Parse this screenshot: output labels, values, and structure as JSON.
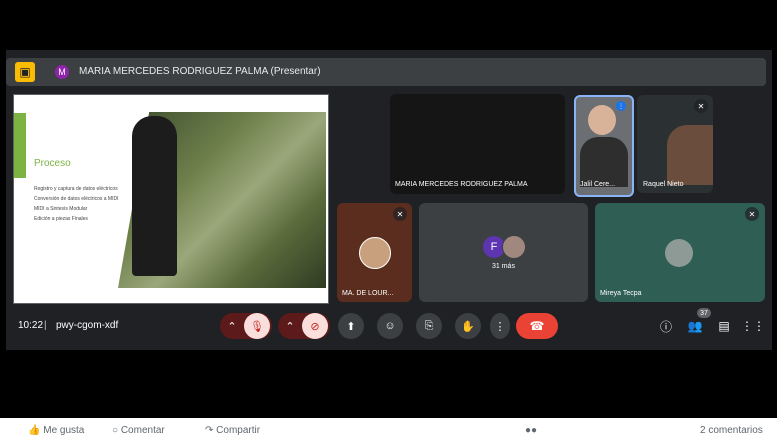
{
  "presenter": {
    "avatar_letter": "M",
    "name": "MARIA MERCEDES RODRIGUEZ PALMA (Presentar)"
  },
  "slide": {
    "title": "Proceso",
    "bullets": [
      "Registro y captura de datos eléctricos",
      "Conversión de datos eléctricos a MIDI",
      "MIDI a Sintesís Modular",
      "Edición a piezas Finales"
    ]
  },
  "participants": {
    "main_name": "MARIA MERCEDES RODRIGUEZ PALMA",
    "jalil": "Jalil Cere...",
    "raquel": "Raquel Nieto",
    "lourdes": "MA. DE LOUR...",
    "more_avatar_letter": "F",
    "more_text": "31 más",
    "mireya": "Mireya Tecpa"
  },
  "controls": {
    "time": "10:22",
    "meeting_code": "pwy-cgom-xdf",
    "participant_count": "37"
  },
  "footer": {
    "like": "Me gusta",
    "comment": "Comentar",
    "share": "Compartir",
    "comments_count": "2 comentarios"
  },
  "colors": {
    "accent_green": "#7cb342",
    "end_call": "#ea4335",
    "presenter_avatar": "#8e24aa",
    "active_speaker": "#8ab4f8"
  }
}
